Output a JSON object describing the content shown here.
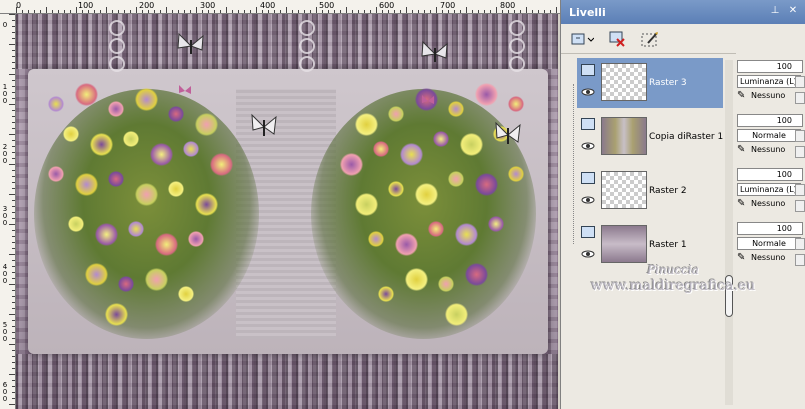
{
  "rulers": {
    "top_labels": [
      "0",
      "100",
      "200",
      "300",
      "400",
      "500",
      "600",
      "700",
      "800"
    ],
    "left_labels": [
      "0",
      "100",
      "200",
      "300",
      "400",
      "500",
      "600"
    ]
  },
  "panel": {
    "title": "Livelli",
    "pin_icon": "pin-icon",
    "close_icon": "close-icon"
  },
  "toolbar": {
    "new_layer_icon": "new-layer-icon",
    "delete_layer_icon": "delete-layer-icon",
    "edit_icon": "brush-edit-icon"
  },
  "layers": [
    {
      "name": "Raster 3",
      "selected": true,
      "opacity": "100",
      "blend": "Luminanza (L)",
      "effect": "Nessuno"
    },
    {
      "name": "Copia diRaster 1",
      "selected": false,
      "opacity": "100",
      "blend": "Normale",
      "effect": "Nessuno"
    },
    {
      "name": "Raster 2",
      "selected": false,
      "opacity": "100",
      "blend": "Luminanza (L)",
      "effect": "Nessuno"
    },
    {
      "name": "Raster 1",
      "selected": false,
      "opacity": "100",
      "blend": "Normale",
      "effect": "Nessuno"
    }
  ],
  "watermark": {
    "line1": "Pinuccia",
    "line2": "www.maldiregrafica.eu"
  },
  "colors": {
    "panel_header": "#5b7fb6",
    "selected_row": "#7a9ac8"
  }
}
